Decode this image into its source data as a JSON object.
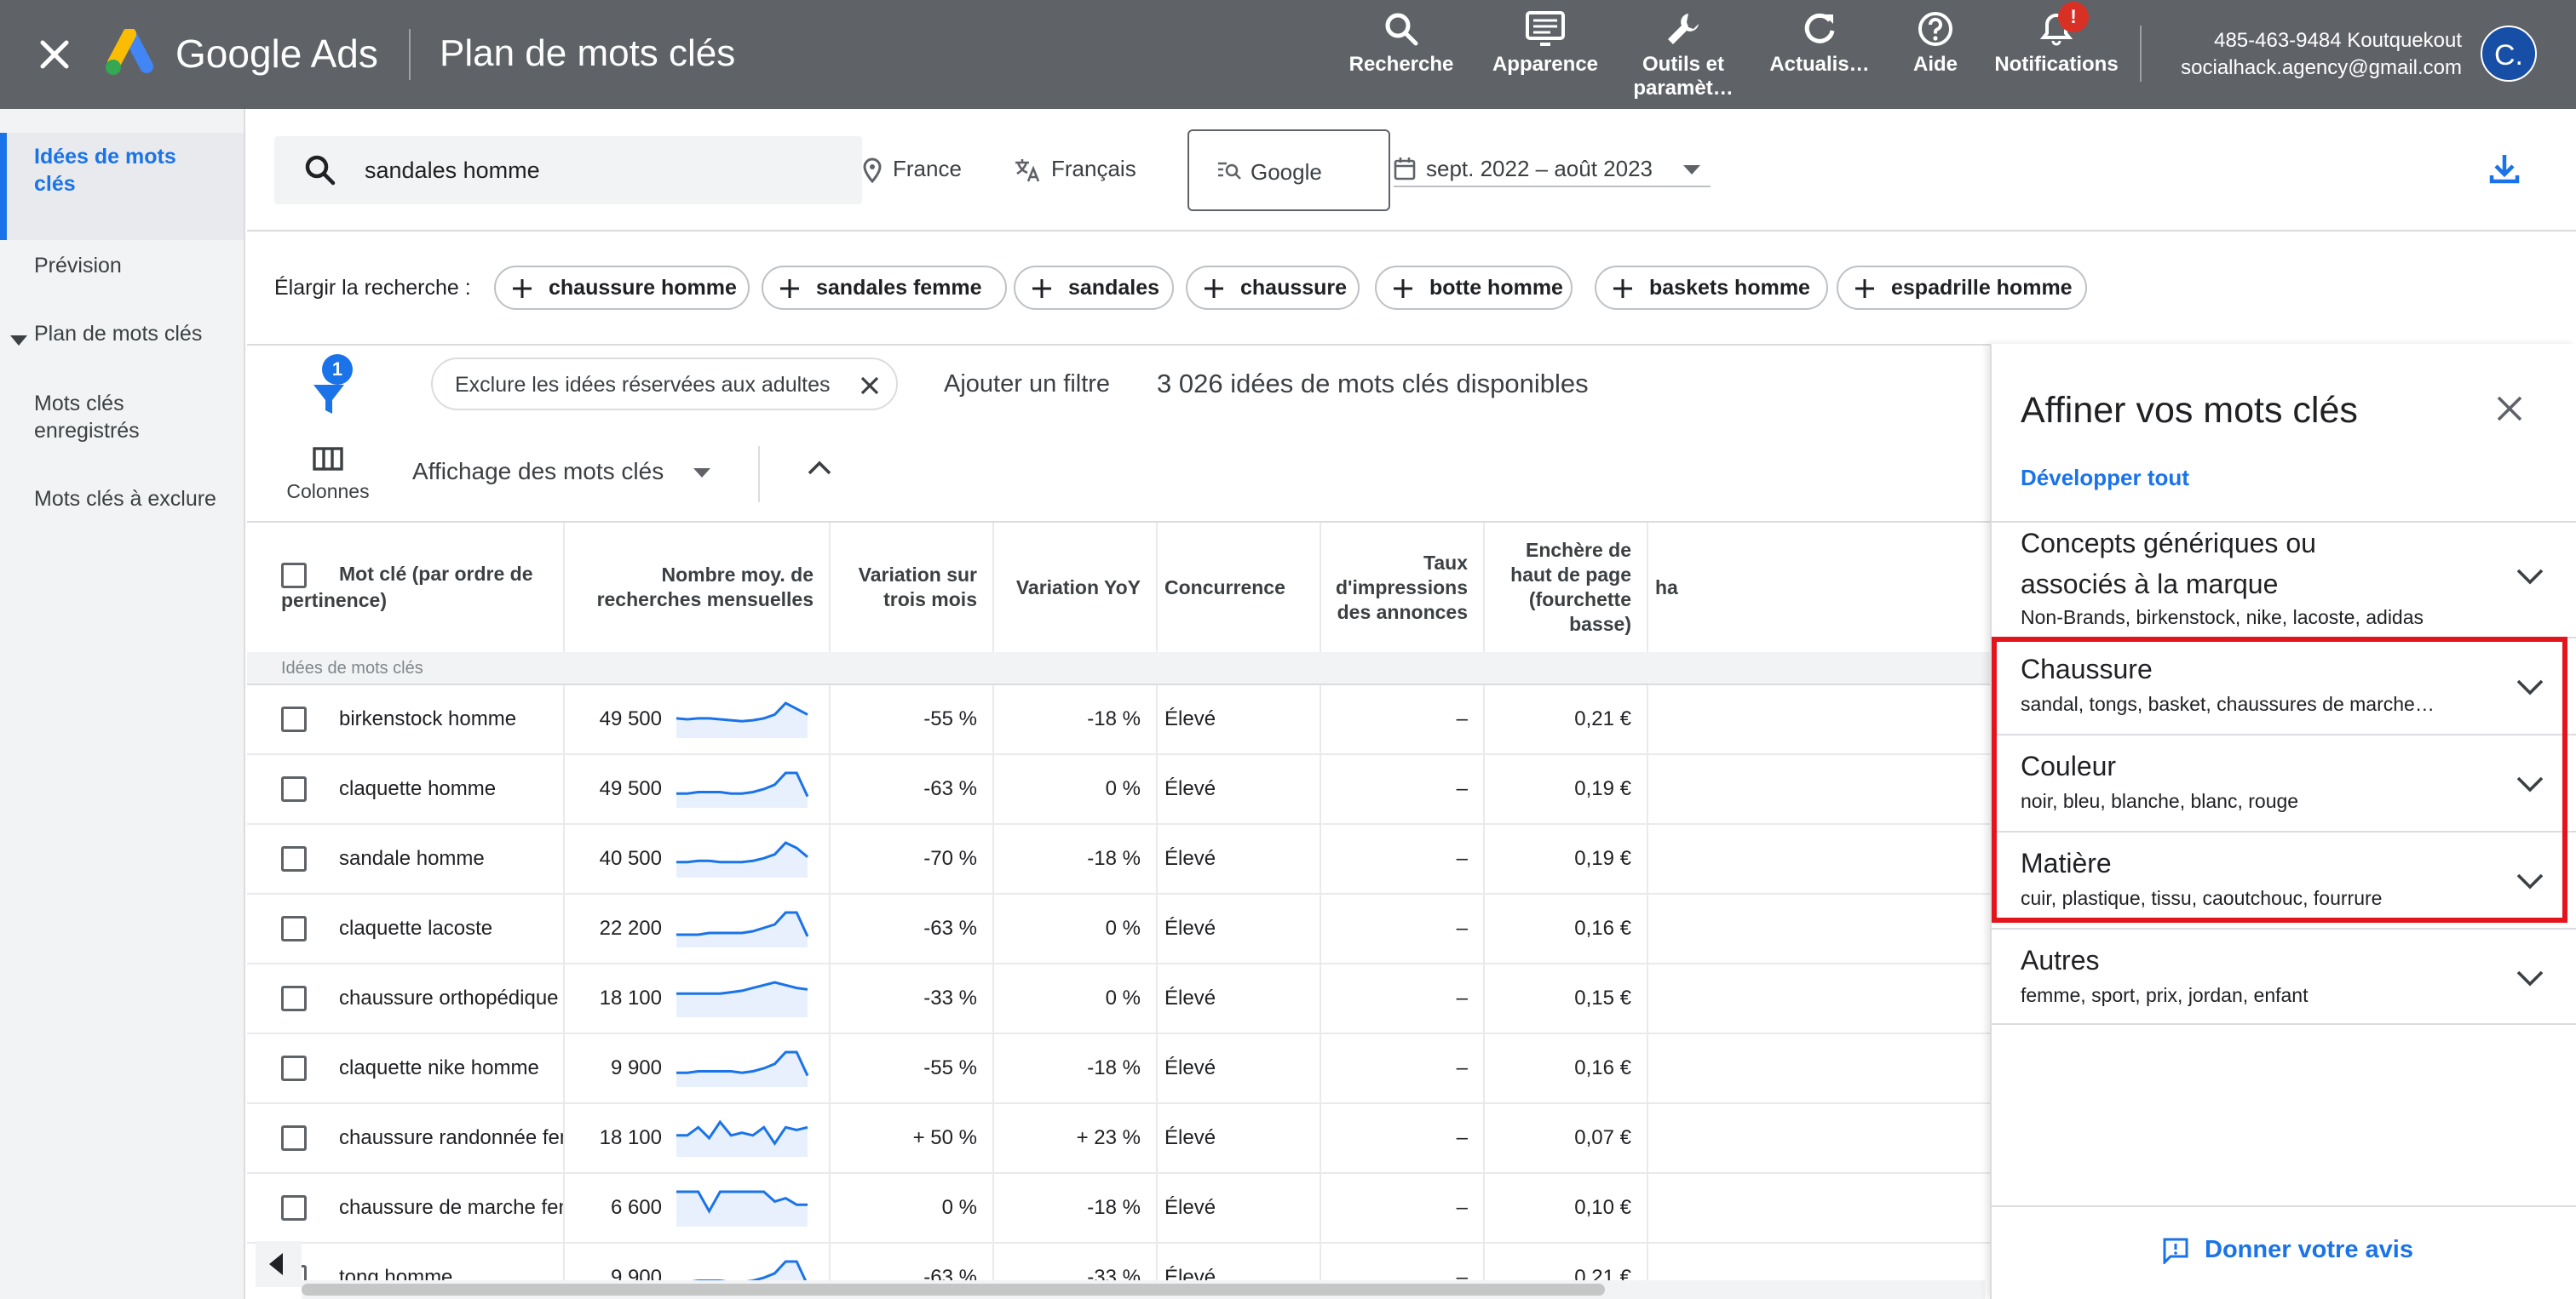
{
  "header": {
    "brand": "Google Ads",
    "page_title": "Plan de mots clés",
    "nav": [
      {
        "label": "Recherche",
        "icon": "search-icon"
      },
      {
        "label": "Apparence",
        "icon": "appearance-icon"
      },
      {
        "label": "Outils et paramèt…",
        "icon": "wrench-icon"
      },
      {
        "label": "Actualis…",
        "icon": "refresh-icon"
      },
      {
        "label": "Aide",
        "icon": "help-icon"
      },
      {
        "label": "Notifications",
        "icon": "bell-icon",
        "badge": "!"
      }
    ],
    "account_id": "485-463-9484 Koutquekout",
    "account_email": "socialhack.agency@gmail.com",
    "avatar_letter": "C."
  },
  "sidebar": {
    "items": [
      {
        "label": "Idées de mots clés",
        "active": true
      },
      {
        "label": "Prévision"
      },
      {
        "label": "Plan de mots clés"
      },
      {
        "label": "Mots clés enregistrés"
      },
      {
        "label": "Mots clés à exclure"
      }
    ]
  },
  "search": {
    "query": "sandales homme",
    "location": "France",
    "language": "Français",
    "network": "Google",
    "date_range": "sept. 2022 – août 2023"
  },
  "broaden": {
    "label": "Élargir la recherche :",
    "chips": [
      "chaussure homme",
      "sandales femme",
      "sandales",
      "chaussure",
      "botte homme",
      "baskets homme",
      "espadrille homme"
    ]
  },
  "toolbar": {
    "filter_count": "1",
    "exclude_chip": "Exclure les idées réservées aux adultes",
    "add_filter": "Ajouter un filtre",
    "ideas_count": "3 026 idées de mots clés disponibles",
    "columns_label": "Colonnes",
    "view_label": "Affichage des mots clés"
  },
  "table": {
    "headers": [
      "Mot clé (par ordre de pertinence)",
      "Nombre moy. de recherches mensuelles",
      "Variation sur trois mois",
      "Variation YoY",
      "Concurrence",
      "Taux d'impressions des annonces",
      "Enchère de haut de page (fourchette basse)",
      "ha"
    ],
    "group_label": "Idées de mots clés",
    "rows": [
      {
        "keyword": "birkenstock homme",
        "volume": "49 500",
        "trend": [
          18,
          17,
          18,
          18,
          17,
          16,
          15,
          16,
          18,
          22,
          34,
          28,
          22
        ],
        "three_month": "-55 %",
        "yoy": "-18 %",
        "competition": "Élevé",
        "impr": "–",
        "bid_low": "0,21 €"
      },
      {
        "keyword": "claquette homme",
        "volume": "49 500",
        "trend": [
          8,
          8,
          9,
          9,
          9,
          8,
          8,
          9,
          11,
          14,
          22,
          22,
          6
        ],
        "three_month": "-63 %",
        "yoy": "0 %",
        "competition": "Élevé",
        "impr": "–",
        "bid_low": "0,19 €"
      },
      {
        "keyword": "sandale homme",
        "volume": "40 500",
        "trend": [
          10,
          10,
          11,
          11,
          10,
          10,
          10,
          11,
          13,
          16,
          25,
          21,
          14
        ],
        "three_month": "-70 %",
        "yoy": "-18 %",
        "competition": "Élevé",
        "impr": "–",
        "bid_low": "0,19 €"
      },
      {
        "keyword": "claquette lacoste",
        "volume": "22 200",
        "trend": [
          6,
          6,
          6,
          7,
          7,
          7,
          7,
          8,
          10,
          12,
          19,
          19,
          5
        ],
        "three_month": "-63 %",
        "yoy": "0 %",
        "competition": "Élevé",
        "impr": "–",
        "bid_low": "0,16 €"
      },
      {
        "keyword": "chaussure orthopédique femme",
        "volume": "18 100",
        "trend": [
          15,
          15,
          15,
          15,
          15,
          16,
          17,
          19,
          21,
          23,
          21,
          19,
          18
        ],
        "three_month": "-33 %",
        "yoy": "0 %",
        "competition": "Élevé",
        "impr": "–",
        "bid_low": "0,15 €"
      },
      {
        "keyword": "claquette nike homme",
        "volume": "9 900",
        "trend": [
          8,
          8,
          9,
          9,
          9,
          9,
          8,
          9,
          11,
          14,
          22,
          22,
          6
        ],
        "three_month": "-55 %",
        "yoy": "-18 %",
        "competition": "Élevé",
        "impr": "–",
        "bid_low": "0,16 €"
      },
      {
        "keyword": "chaussure randonnée femme",
        "volume": "18 100",
        "trend": [
          14,
          14,
          20,
          12,
          24,
          14,
          16,
          14,
          20,
          8,
          20,
          18,
          20
        ],
        "three_month": "+ 50 %",
        "yoy": "+ 23 %",
        "competition": "Élevé",
        "impr": "–",
        "bid_low": "0,07 €"
      },
      {
        "keyword": "chaussure de marche femme",
        "volume": "6 600",
        "trend": [
          20,
          20,
          20,
          8,
          20,
          20,
          20,
          20,
          20,
          14,
          16,
          12,
          12
        ],
        "three_month": "0 %",
        "yoy": "-18 %",
        "competition": "Élevé",
        "impr": "–",
        "bid_low": "0,10 €"
      },
      {
        "keyword": "tong homme",
        "volume": "9 900",
        "trend": [
          8,
          8,
          9,
          9,
          9,
          8,
          8,
          9,
          11,
          14,
          22,
          22,
          6
        ],
        "three_month": "-63 %",
        "yoy": "-33 %",
        "competition": "Élevé",
        "impr": "–",
        "bid_low": "0,21 €"
      }
    ]
  },
  "refine": {
    "title": "Affiner vos mots clés",
    "expand_all": "Développer tout",
    "items": [
      {
        "title_line1": "Concepts génériques ou",
        "title_line2": "associés à la marque",
        "sub": "Non-Brands, birkenstock, nike, lacoste, adidas"
      },
      {
        "title": "Chaussure",
        "sub": "sandal, tongs, basket, chaussures de marche…"
      },
      {
        "title": "Couleur",
        "sub": "noir, bleu, blanche, blanc, rouge"
      },
      {
        "title": "Matière",
        "sub": "cuir, plastique, tissu, caoutchouc, fourrure"
      },
      {
        "title": "Autres",
        "sub": "femme, sport, prix, jordan, enfant"
      }
    ],
    "feedback": "Donner votre avis"
  },
  "colors": {
    "header": "#5f6368",
    "accent": "#1a73e8",
    "highlight": "#e3141b",
    "badge": "#d93025"
  }
}
